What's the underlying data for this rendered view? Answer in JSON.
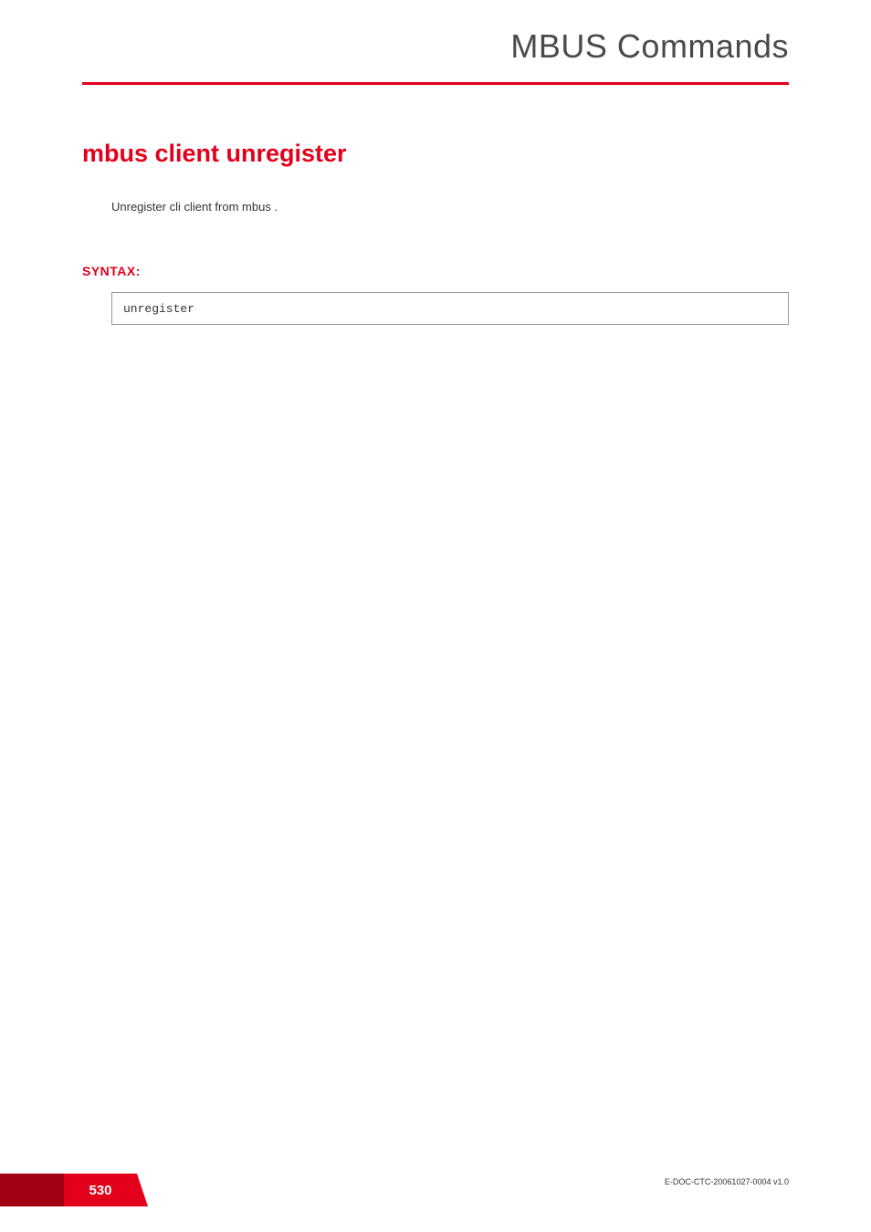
{
  "header": {
    "chapter_title": "MBUS Commands"
  },
  "content": {
    "command_title": "mbus client unregister",
    "description": "Unregister cli client from mbus .",
    "syntax_label": "SYNTAX:",
    "syntax_code": "unregister"
  },
  "footer": {
    "doc_id": "E-DOC-CTC-20061027-0004 v1.0",
    "page_number": "530"
  },
  "colors": {
    "accent_red": "#e2001a",
    "dark_red": "#a00012"
  }
}
